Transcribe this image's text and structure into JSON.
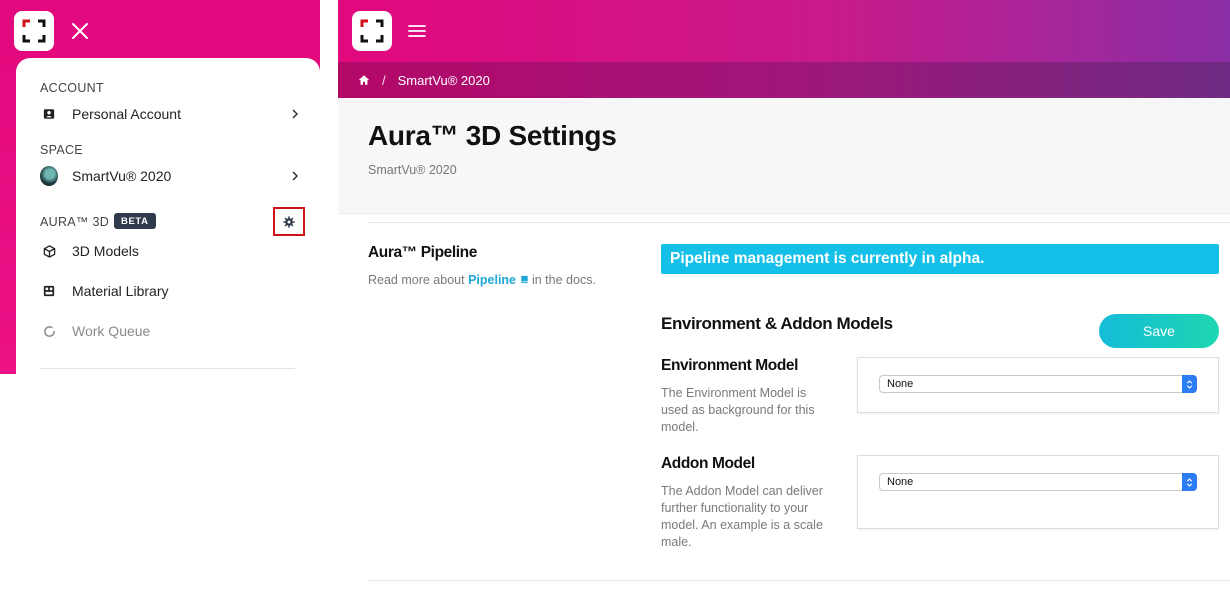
{
  "drawer": {
    "account_label": "ACCOUNT",
    "account_item": "Personal Account",
    "space_label": "SPACE",
    "space_item": "SmartVu® 2020",
    "aura_label": "AURA™ 3D",
    "beta_badge": "BETA",
    "items": [
      {
        "label": "3D Models",
        "icon": "cube-icon"
      },
      {
        "label": "Material Library",
        "icon": "material-icon"
      },
      {
        "label": "Work Queue",
        "icon": "spinner-icon",
        "muted": true
      }
    ]
  },
  "header": {
    "breadcrumb": {
      "current": "SmartVu® 2020"
    }
  },
  "page": {
    "title": "Aura™ 3D Settings",
    "subtitle": "SmartVu® 2020"
  },
  "pipeline": {
    "title": "Aura™ Pipeline",
    "desc_prefix": "Read more about",
    "link_text": "Pipeline",
    "desc_suffix": "in the docs.",
    "alert": "Pipeline management is currently in alpha."
  },
  "models": {
    "section_title": "Environment & Addon Models",
    "save_label": "Save",
    "environment": {
      "title": "Environment Model",
      "desc": "The Environment Model is used as background for this model.",
      "value": "None"
    },
    "addon": {
      "title": "Addon Model",
      "desc": "The Addon Model can deliver further functionality to your model. An example is a scale male.",
      "value": "None"
    }
  },
  "colors": {
    "brand_pink": "#e2087d",
    "accent_cyan": "#15c0e8",
    "highlight_red": "#d0121b"
  }
}
